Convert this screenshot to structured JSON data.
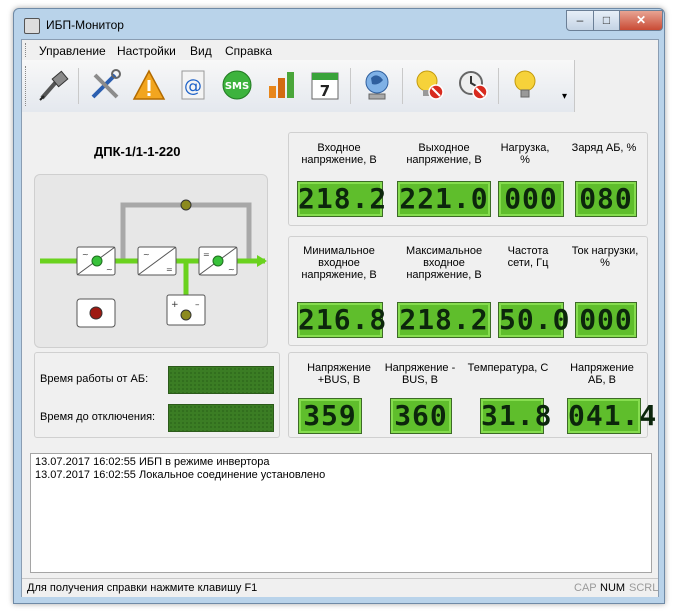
{
  "window": {
    "title": "ИБП-Монитор",
    "minimize": "–",
    "maximize": "□",
    "close": "✕"
  },
  "menu": [
    "Управление",
    "Настройки",
    "Вид",
    "Справка"
  ],
  "toolbar": [
    "connect-icon",
    "tools-icon",
    "warning-icon",
    "email-icon",
    "sms-icon",
    "chart-icon",
    "calendar-icon",
    "network-icon",
    "bulb-off-icon",
    "alarm-off-icon",
    "bulb-icon"
  ],
  "calendar_day": "7",
  "sms_label": "SMS",
  "device": {
    "name": "ДПК-1/1-1-220"
  },
  "panel1": {
    "labels": [
      "Входное напряжение, В",
      "Выходное напряжение, В",
      "Нагрузка, %",
      "Заряд АБ, %"
    ],
    "values": [
      "218.2",
      "221.0",
      "000",
      "080"
    ]
  },
  "panel2": {
    "labels": [
      "Минимальное входное напряжение, В",
      "Максимальное входное напряжение, В",
      "Частота сети, Гц",
      "Ток нагрузки, %"
    ],
    "values": [
      "216.8",
      "218.2",
      "50.0",
      "000"
    ]
  },
  "panel3": {
    "labels": [
      "Напряжение +BUS, В",
      "Напряжение -BUS, В",
      "Температура, С",
      "Напряжение АБ, В"
    ],
    "values": [
      "359",
      "360",
      "31.8",
      "041.4"
    ]
  },
  "battery": {
    "runtime_label": "Время работы от АБ:",
    "shutdown_label": "Время до отключения:"
  },
  "log": [
    "13.07.2017 16:02:55 ИБП в режиме инвертора",
    "13.07.2017 16:02:55 Локальное соединение установлено"
  ],
  "status": {
    "text": "Для получения справки нажмите клавишу F1",
    "cap": "CAP",
    "num": "NUM",
    "scrl": "SCRL"
  },
  "colors": {
    "lcd": "#5fbe2c",
    "power_line": "#6ad21e",
    "indicator_green": "#38c23a",
    "indicator_olive": "#8c8a1e",
    "indicator_red": "#9e1a12"
  }
}
